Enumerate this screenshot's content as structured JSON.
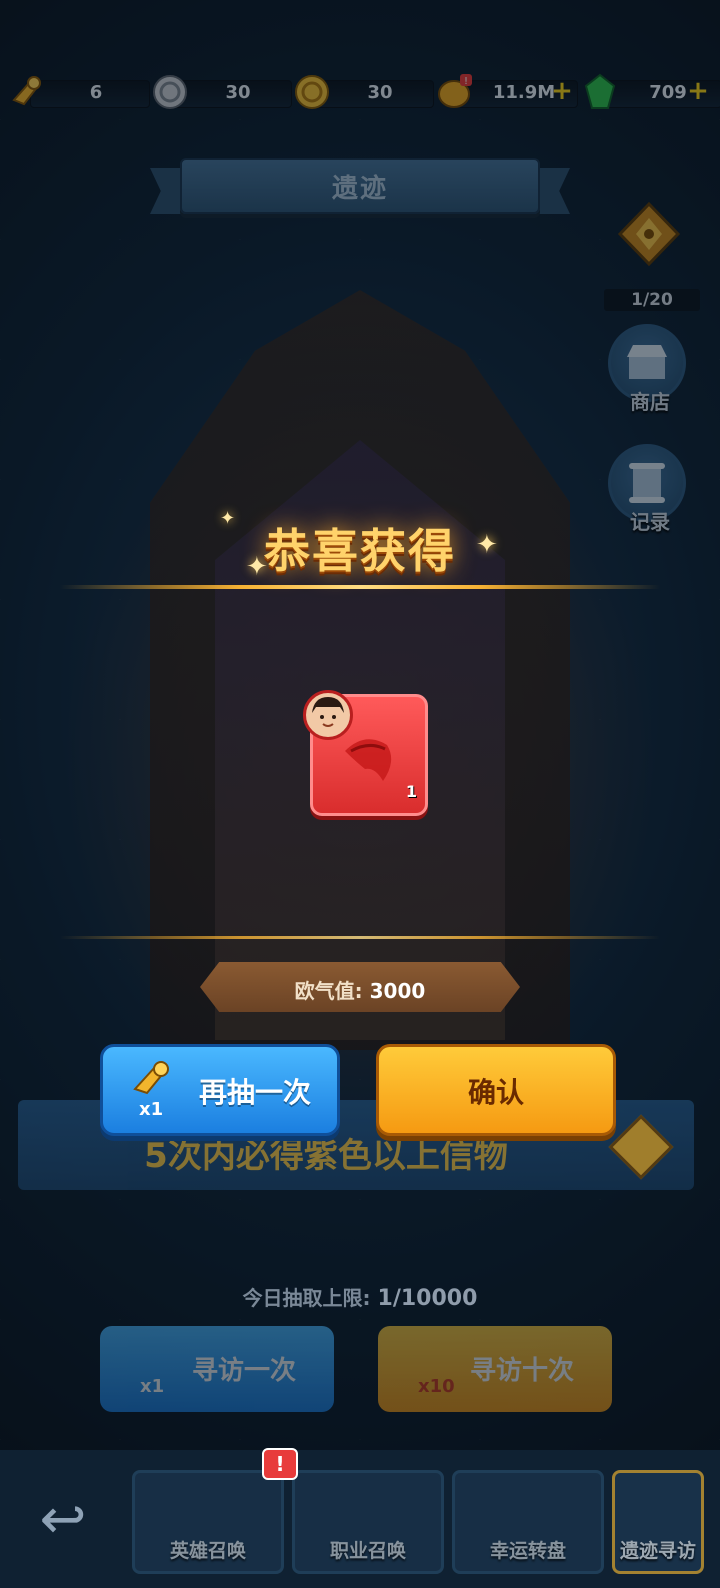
{
  "currencies": [
    {
      "name": "key-ticket",
      "value": "6",
      "has_plus": false
    },
    {
      "name": "silver-coin",
      "value": "30",
      "has_plus": false
    },
    {
      "name": "gold-coin",
      "value": "30",
      "has_plus": false
    },
    {
      "name": "gold",
      "value": "11.9M",
      "has_plus": true
    },
    {
      "name": "green-gem",
      "value": "709",
      "has_plus": true
    }
  ],
  "plus_symbol": "+",
  "title": "遗迹",
  "side": {
    "progress": "1/20",
    "shop_label": "商店",
    "records_label": "记录"
  },
  "reward": {
    "heading": "恭喜获得",
    "item_count": "1",
    "luck_label": "欧气值:",
    "luck_value": "3000"
  },
  "actions": {
    "retry_label": "再抽一次",
    "retry_cost": "x1",
    "confirm_label": "确认"
  },
  "guarantee_text": "5次内必得紫色以上信物",
  "daily_limit": {
    "label": "今日抽取上限:",
    "value": "1/10000"
  },
  "draw_buttons": [
    {
      "label": "寻访一次",
      "cost": "x1"
    },
    {
      "label": "寻访十次",
      "cost": "x10"
    }
  ],
  "nav_tabs": [
    {
      "label": "英雄召唤"
    },
    {
      "label": "职业召唤"
    },
    {
      "label": "幸运转盘"
    },
    {
      "label": "遗迹寻访"
    }
  ],
  "nav_badge": "!",
  "colors": {
    "accent_gold": "#ffd36b",
    "button_blue": "#1b7fe0",
    "button_orange": "#f59a12",
    "item_red": "#e23a3a"
  }
}
